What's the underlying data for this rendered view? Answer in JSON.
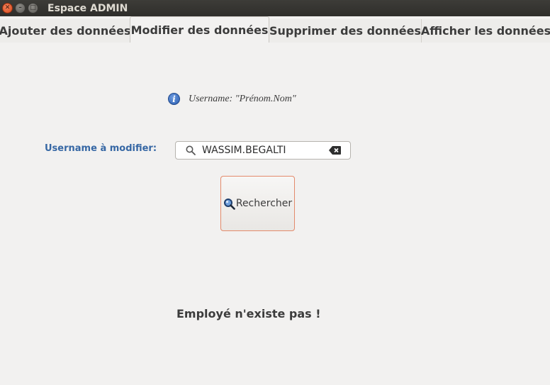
{
  "window": {
    "title": "Espace ADMIN"
  },
  "tabs": [
    {
      "label": "Ajouter des données",
      "active": false
    },
    {
      "label": "Modifier des données",
      "active": true
    },
    {
      "label": "Supprimer des données",
      "active": false
    },
    {
      "label": "Afficher les données",
      "active": false
    }
  ],
  "info": {
    "icon": "info-icon",
    "text": "Username: \"Prénom.Nom\""
  },
  "form": {
    "field_label": "Username à modifier:",
    "search_value": "WASSIM.BEGALTI",
    "search_button_label": "Rechercher"
  },
  "status": {
    "message": "Employé n'existe pas !"
  },
  "colors": {
    "label_blue": "#3667a4",
    "button_border": "#e38a6b",
    "close_button": "#e05a2b"
  }
}
